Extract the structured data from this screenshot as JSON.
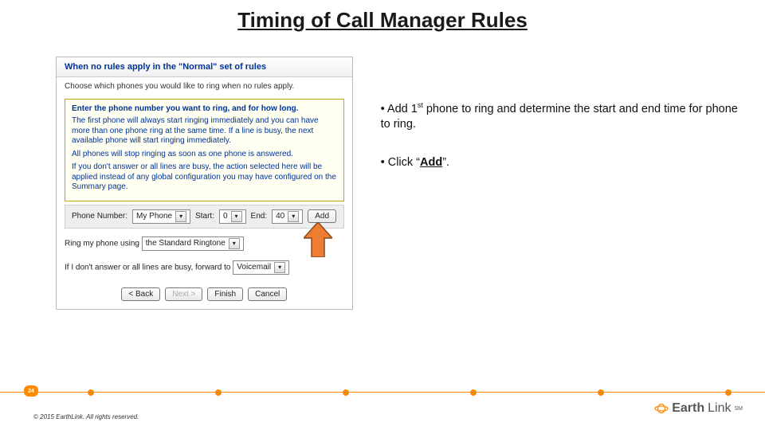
{
  "title": "Timing of Call Manager Rules",
  "screenshot": {
    "header": "When no rules apply in the \"Normal\" set of rules",
    "sub": "Choose which phones you would like to ring when no rules apply.",
    "yellow": {
      "title": "Enter the phone number you want to ring, and for how long.",
      "p1": "The first phone will always start ringing immediately and you can have more than one phone ring at the same time. If a line is busy, the next available phone will start ringing immediately.",
      "p2": "All phones will stop ringing as soon as one phone is answered.",
      "p3": "If you don't answer or all lines are busy, the action selected here will be applied instead of any global configuration you may have configured on the Summary page."
    },
    "row": {
      "phone_label": "Phone Number:",
      "phone_value": "My Phone",
      "start_label": "Start:",
      "start_value": "0",
      "end_label": "End:",
      "end_value": "40",
      "add": "Add"
    },
    "ringtone_line_prefix": "Ring my phone using",
    "ringtone_value": "the Standard Ringtone",
    "forward_line_prefix": "If I don't answer or all lines are busy, forward to",
    "forward_value": "Voicemail",
    "buttons": {
      "back": "< Back",
      "next": "Next >",
      "finish": "Finish",
      "cancel": "Cancel"
    }
  },
  "bullets": {
    "b1_pre": " Add 1",
    "b1_sup": "st",
    "b1_post": " phone to ring and determine the start and end time for phone to ring.",
    "b2_pre": "Click “",
    "b2_bold": "Add",
    "b2_post": "”."
  },
  "slide_number": "24",
  "copyright": "© 2015 EarthLink. All rights reserved.",
  "brand_a": "Earth",
  "brand_b": "Link",
  "brand_sm": "SM"
}
